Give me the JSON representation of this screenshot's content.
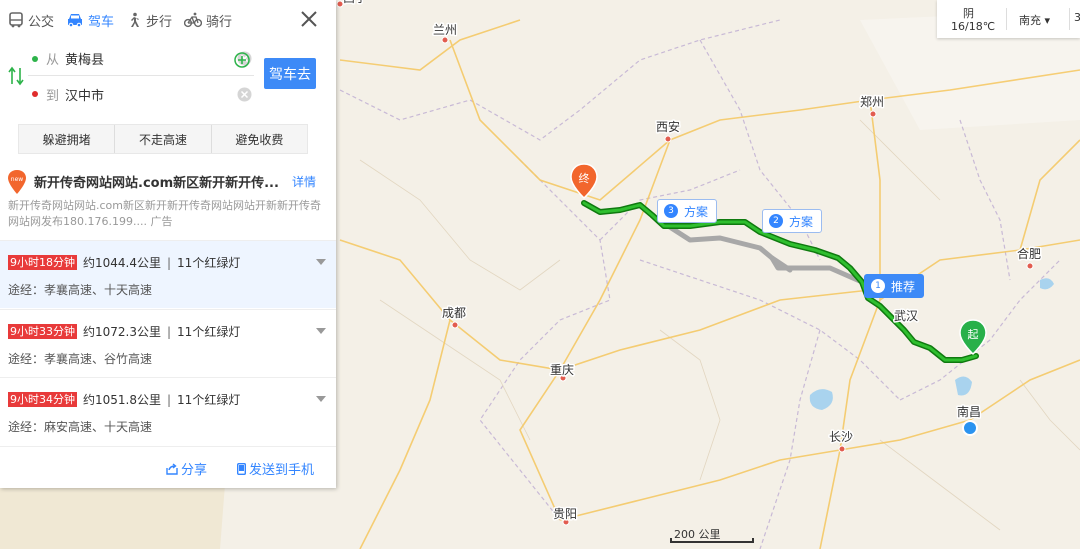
{
  "tabs": [
    {
      "label": "公交",
      "icon": "bus-icon"
    },
    {
      "label": "驾车",
      "icon": "car-icon",
      "active": true
    },
    {
      "label": "步行",
      "icon": "walk-icon"
    },
    {
      "label": "骑行",
      "icon": "bike-icon"
    }
  ],
  "route": {
    "from_prefix": "从",
    "from_value": "黄梅县",
    "to_prefix": "到",
    "to_value": "汉中市",
    "go_label": "驾车去"
  },
  "preferences": [
    "躲避拥堵",
    "不走高速",
    "避免收费"
  ],
  "ad": {
    "title": "新开传奇网站网站.com新区新开新开传...",
    "detail_label": "详情",
    "desc": "新开传奇网站网站.com新区新开新开传奇网站网站开新新开传奇网站网发布180.176.199.... 广告"
  },
  "routes": [
    {
      "time": "9小时18分钟",
      "distance": "约1044.4公里",
      "lights": "11个红绿灯",
      "via": "途经：孝襄高速、十天高速",
      "selected": true
    },
    {
      "time": "9小时33分钟",
      "distance": "约1072.3公里",
      "lights": "11个红绿灯",
      "via": "途经：孝襄高速、谷竹高速",
      "selected": false
    },
    {
      "time": "9小时34分钟",
      "distance": "约1051.8公里",
      "lights": "11个红绿灯",
      "via": "途经：麻安高速、十天高速",
      "selected": false
    }
  ],
  "footer": {
    "share_label": "分享",
    "send_label": "发送到手机"
  },
  "weather": {
    "condition": "阴",
    "temp": "16/18℃",
    "city": "南充",
    "more": "3"
  },
  "map": {
    "cities": [
      "西宁",
      "兰州",
      "郑州",
      "西安",
      "合肥",
      "成都",
      "重庆",
      "武汉",
      "长沙",
      "南昌",
      "贵阳"
    ],
    "start_label": "起",
    "end_label": "终",
    "plans": [
      {
        "num": "1",
        "label": "推荐"
      },
      {
        "num": "2",
        "label": "方案"
      },
      {
        "num": "3",
        "label": "方案"
      }
    ],
    "scale_label": "200 公里"
  },
  "colors": {
    "accent": "#3385ff",
    "route_main": "#1a9e1a",
    "route_alt": "#a8a8a8",
    "time_badge": "#e83a3a"
  }
}
